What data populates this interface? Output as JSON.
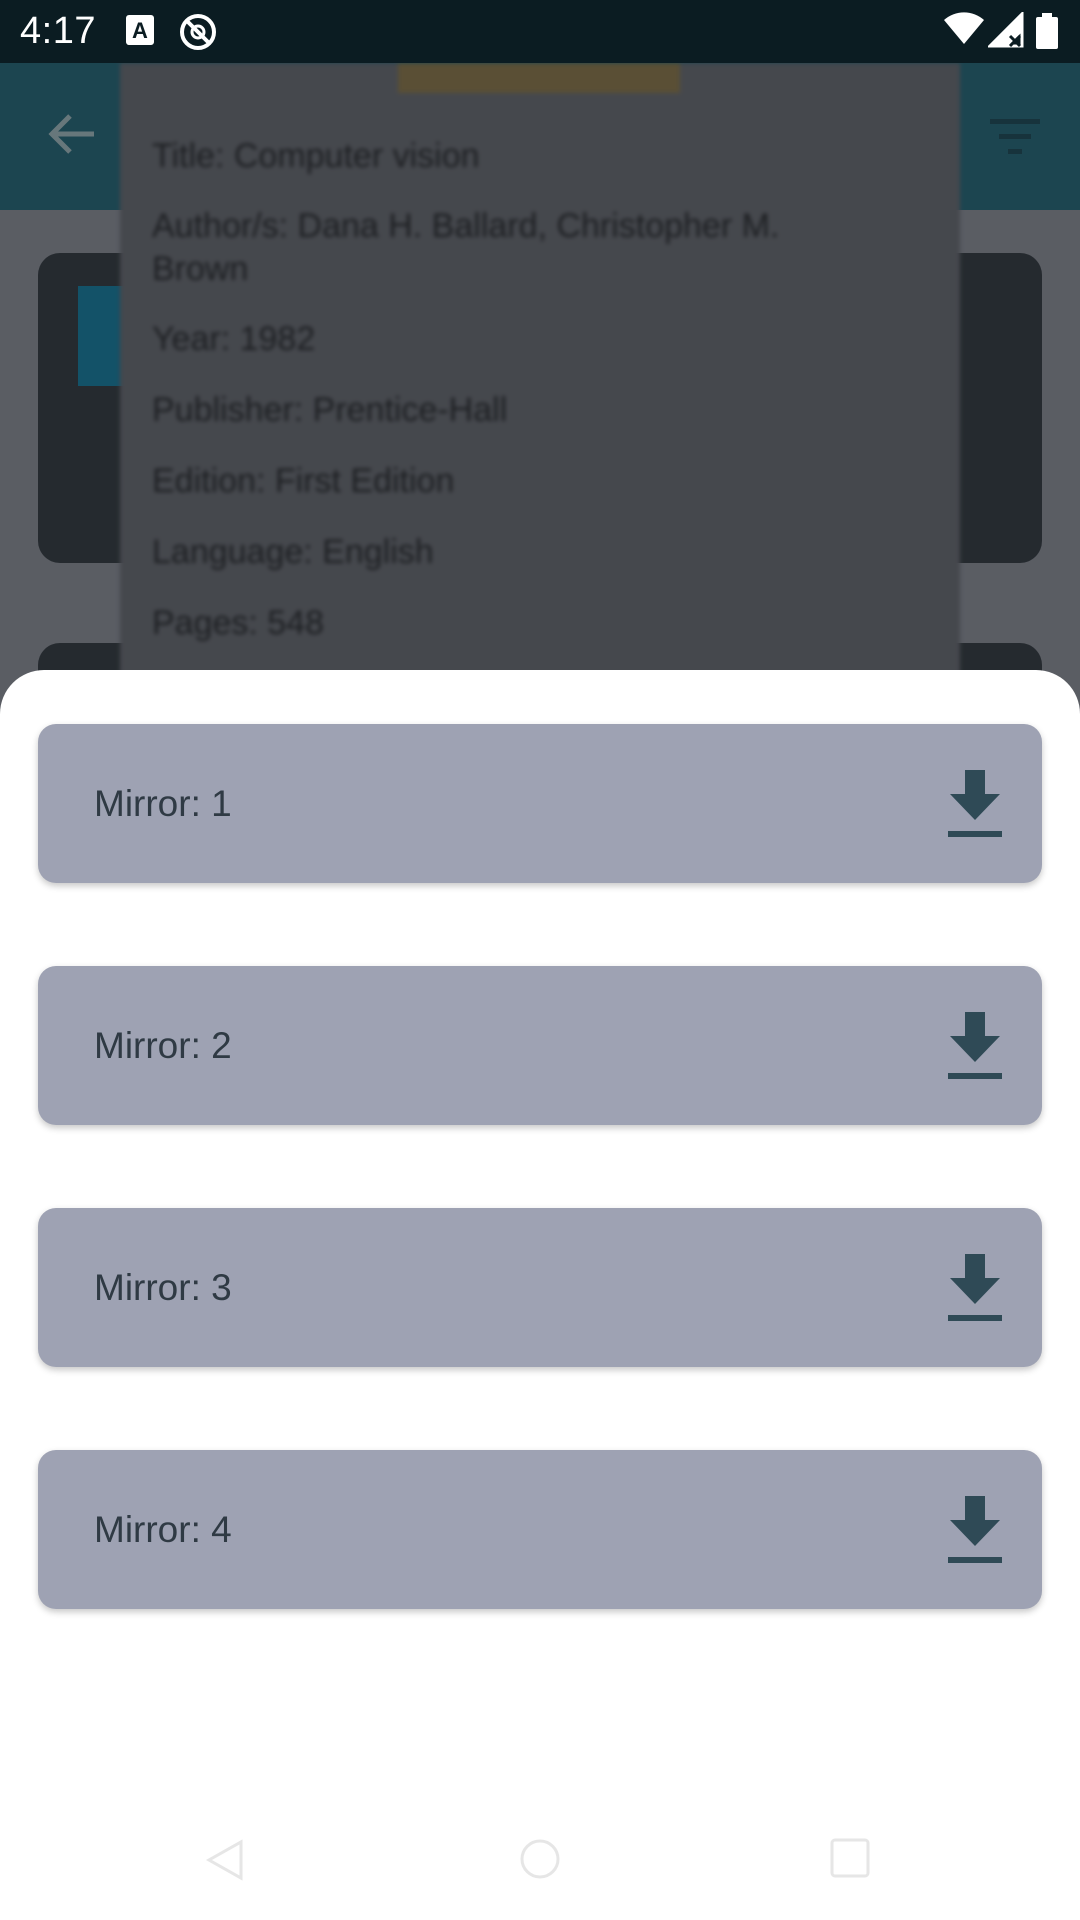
{
  "status_bar": {
    "time": "4:17",
    "icons": [
      "a-badge-icon",
      "no-sync-icon",
      "wifi-icon",
      "signal-icon",
      "battery-icon"
    ]
  },
  "background": {
    "book_details": [
      "Title: Computer vision",
      "Author/s: Dana H. Ballard, Christopher M. Brown",
      "Year: 1982",
      "Publisher: Prentice-Hall",
      "Edition: First Edition",
      "Language: English",
      "Pages: 548"
    ]
  },
  "sheet": {
    "mirrors": [
      {
        "label": "Mirror: 1"
      },
      {
        "label": "Mirror: 2"
      },
      {
        "label": "Mirror: 3"
      },
      {
        "label": "Mirror: 4"
      }
    ]
  },
  "colors": {
    "accent": "#2c6a7c",
    "mirror_bg": "#9ea2b3",
    "icon": "#2f4a56"
  }
}
